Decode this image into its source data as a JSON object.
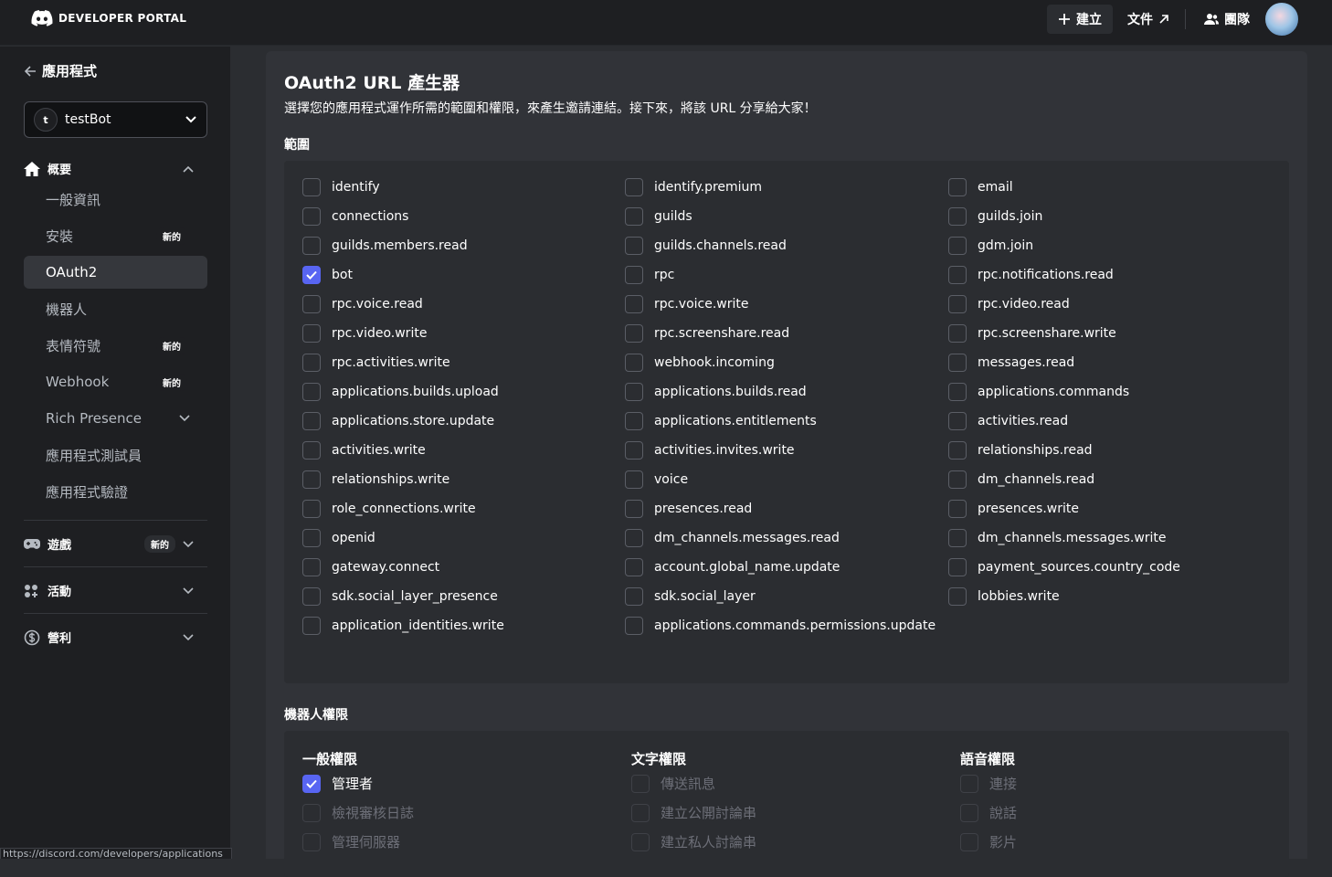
{
  "topbar": {
    "brand": "DEVELOPER PORTAL",
    "create_label": "建立",
    "docs_label": "文件",
    "team_label": "團隊"
  },
  "sidebar": {
    "back_label": "應用程式",
    "app_name": "testBot",
    "app_initial": "t",
    "overview_label": "概要",
    "new_tag": "新的",
    "items": [
      {
        "label": "一般資訊"
      },
      {
        "label": "安裝"
      },
      {
        "label": "OAuth2"
      },
      {
        "label": "機器人"
      },
      {
        "label": "表情符號"
      },
      {
        "label": "Webhook"
      },
      {
        "label": "Rich Presence"
      },
      {
        "label": "應用程式測試員"
      },
      {
        "label": "應用程式驗證"
      }
    ],
    "games_label": "遊戲",
    "activities_label": "活動",
    "monetization_label": "營利",
    "status_url": "https://discord.com/developers/applications"
  },
  "main": {
    "title": "OAuth2 URL 產生器",
    "subtitle": "選擇您的應用程式運作所需的範圍和權限，來產生邀請連結。接下來，將該 URL 分享給大家！",
    "scopes_heading": "範圍",
    "scopes": [
      {
        "label": "identify",
        "checked": false
      },
      {
        "label": "identify.premium",
        "checked": false
      },
      {
        "label": "email",
        "checked": false
      },
      {
        "label": "connections",
        "checked": false
      },
      {
        "label": "guilds",
        "checked": false
      },
      {
        "label": "guilds.join",
        "checked": false
      },
      {
        "label": "guilds.members.read",
        "checked": false
      },
      {
        "label": "guilds.channels.read",
        "checked": false
      },
      {
        "label": "gdm.join",
        "checked": false
      },
      {
        "label": "bot",
        "checked": true
      },
      {
        "label": "rpc",
        "checked": false
      },
      {
        "label": "rpc.notifications.read",
        "checked": false
      },
      {
        "label": "rpc.voice.read",
        "checked": false
      },
      {
        "label": "rpc.voice.write",
        "checked": false
      },
      {
        "label": "rpc.video.read",
        "checked": false
      },
      {
        "label": "rpc.video.write",
        "checked": false
      },
      {
        "label": "rpc.screenshare.read",
        "checked": false
      },
      {
        "label": "rpc.screenshare.write",
        "checked": false
      },
      {
        "label": "rpc.activities.write",
        "checked": false
      },
      {
        "label": "webhook.incoming",
        "checked": false
      },
      {
        "label": "messages.read",
        "checked": false
      },
      {
        "label": "applications.builds.upload",
        "checked": false
      },
      {
        "label": "applications.builds.read",
        "checked": false
      },
      {
        "label": "applications.commands",
        "checked": false
      },
      {
        "label": "applications.store.update",
        "checked": false
      },
      {
        "label": "applications.entitlements",
        "checked": false
      },
      {
        "label": "activities.read",
        "checked": false
      },
      {
        "label": "activities.write",
        "checked": false
      },
      {
        "label": "activities.invites.write",
        "checked": false
      },
      {
        "label": "relationships.read",
        "checked": false
      },
      {
        "label": "relationships.write",
        "checked": false
      },
      {
        "label": "voice",
        "checked": false
      },
      {
        "label": "dm_channels.read",
        "checked": false
      },
      {
        "label": "role_connections.write",
        "checked": false
      },
      {
        "label": "presences.read",
        "checked": false
      },
      {
        "label": "presences.write",
        "checked": false
      },
      {
        "label": "openid",
        "checked": false
      },
      {
        "label": "dm_channels.messages.read",
        "checked": false
      },
      {
        "label": "dm_channels.messages.write",
        "checked": false
      },
      {
        "label": "gateway.connect",
        "checked": false
      },
      {
        "label": "account.global_name.update",
        "checked": false
      },
      {
        "label": "payment_sources.country_code",
        "checked": false
      },
      {
        "label": "sdk.social_layer_presence",
        "checked": false
      },
      {
        "label": "sdk.social_layer",
        "checked": false
      },
      {
        "label": "lobbies.write",
        "checked": false
      },
      {
        "label": "application_identities.write",
        "checked": false
      },
      {
        "label": "applications.commands.permissions.update",
        "checked": false
      }
    ],
    "bot_perms_heading": "機器人權限",
    "perm_groups": [
      {
        "heading": "一般權限",
        "items": [
          {
            "label": "管理者",
            "checked": true,
            "enabled": true
          },
          {
            "label": "檢視審核日誌",
            "checked": false,
            "enabled": false
          },
          {
            "label": "管理伺服器",
            "checked": false,
            "enabled": false
          }
        ]
      },
      {
        "heading": "文字權限",
        "items": [
          {
            "label": "傳送訊息",
            "checked": false,
            "enabled": false
          },
          {
            "label": "建立公開討論串",
            "checked": false,
            "enabled": false
          },
          {
            "label": "建立私人討論串",
            "checked": false,
            "enabled": false
          }
        ]
      },
      {
        "heading": "語音權限",
        "items": [
          {
            "label": "連接",
            "checked": false,
            "enabled": false
          },
          {
            "label": "說話",
            "checked": false,
            "enabled": false
          },
          {
            "label": "影片",
            "checked": false,
            "enabled": false
          }
        ]
      }
    ]
  }
}
